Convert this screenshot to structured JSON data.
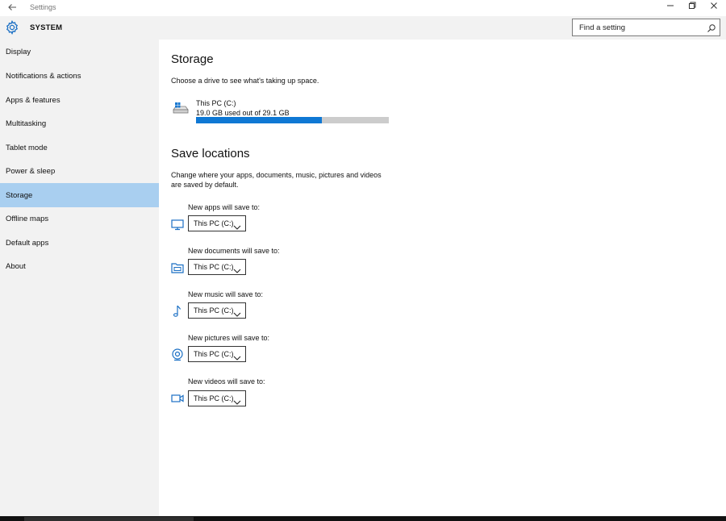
{
  "window": {
    "title": "Settings",
    "back_icon": "back-arrow-icon",
    "controls": [
      "minimize-icon",
      "maximize-icon",
      "close-icon"
    ]
  },
  "header": {
    "icon": "gear-icon",
    "title": "SYSTEM",
    "search_placeholder": "Find a setting",
    "search_icon": "search-icon"
  },
  "sidebar": {
    "items": [
      {
        "label": "Display"
      },
      {
        "label": "Notifications & actions"
      },
      {
        "label": "Apps & features"
      },
      {
        "label": "Multitasking"
      },
      {
        "label": "Tablet mode"
      },
      {
        "label": "Power & sleep"
      },
      {
        "label": "Storage"
      },
      {
        "label": "Offline maps"
      },
      {
        "label": "Default apps"
      },
      {
        "label": "About"
      }
    ],
    "selected_index": 6
  },
  "storage": {
    "title": "Storage",
    "description": "Choose a drive to see what's taking up space.",
    "drive": {
      "icon": "drive-icon",
      "name": "This PC (C:)",
      "usage_text": "19.0 GB used out of 29.1 GB",
      "used_fraction": 0.653
    }
  },
  "save_locations": {
    "title": "Save locations",
    "description_line1": "Change where your apps, documents, music, pictures and videos",
    "description_line2": "are saved by default.",
    "items": [
      {
        "label": "New apps will save to:",
        "icon": "monitor-icon",
        "value": "This PC (C:)"
      },
      {
        "label": "New documents will save to:",
        "icon": "documents-icon",
        "value": "This PC (C:)"
      },
      {
        "label": "New music will save to:",
        "icon": "music-note-icon",
        "value": "This PC (C:)"
      },
      {
        "label": "New pictures will save to:",
        "icon": "camera-icon",
        "value": "This PC (C:)"
      },
      {
        "label": "New videos will save to:",
        "icon": "video-camera-icon",
        "value": "This PC (C:)"
      }
    ]
  },
  "colors": {
    "accent": "#0f78d4",
    "selected_nav": "#a9cff0",
    "sidebar_bg": "#f2f2f2",
    "bar_track": "#cccccc"
  }
}
